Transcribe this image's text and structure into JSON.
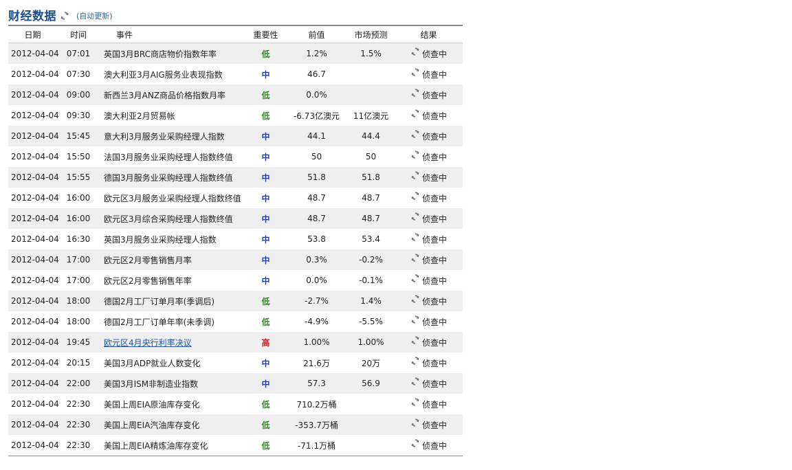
{
  "header": {
    "title": "财经数据",
    "auto_update": "(自动更新)"
  },
  "columns": [
    "日期",
    "时间",
    "事件",
    "重要性",
    "前值",
    "市场预测",
    "结果"
  ],
  "colors": {
    "low": "#2a8a1f",
    "medium": "#1e3fb4",
    "high": "#cc2222",
    "title": "#1f4e8c"
  },
  "rows": [
    {
      "date": "2012-04-04",
      "time": "07:01",
      "event": "英国3月BRC商店物价指数年率",
      "importance": "低",
      "level": "low",
      "previous": "1.2%",
      "forecast": "1.5%",
      "result": "侦查中"
    },
    {
      "date": "2012-04-04",
      "time": "07:30",
      "event": "澳大利亚3月AIG服务业表现指数",
      "importance": "中",
      "level": "medium",
      "previous": "46.7",
      "forecast": "",
      "result": "侦查中"
    },
    {
      "date": "2012-04-04",
      "time": "09:00",
      "event": "新西兰3月ANZ商品价格指数月率",
      "importance": "低",
      "level": "low",
      "previous": "0.0%",
      "forecast": "",
      "result": "侦查中"
    },
    {
      "date": "2012-04-04",
      "time": "09:30",
      "event": "澳大利亚2月贸易帐",
      "importance": "低",
      "level": "low",
      "previous": "-6.73亿澳元",
      "forecast": "11亿澳元",
      "result": "侦查中"
    },
    {
      "date": "2012-04-04",
      "time": "15:45",
      "event": "意大利3月服务业采购经理人指数",
      "importance": "中",
      "level": "medium",
      "previous": "44.1",
      "forecast": "44.4",
      "result": "侦查中"
    },
    {
      "date": "2012-04-04",
      "time": "15:50",
      "event": "法国3月服务业采购经理人指数终值",
      "importance": "中",
      "level": "medium",
      "previous": "50",
      "forecast": "50",
      "result": "侦查中"
    },
    {
      "date": "2012-04-04",
      "time": "15:55",
      "event": "德国3月服务业采购经理人指数终值",
      "importance": "中",
      "level": "medium",
      "previous": "51.8",
      "forecast": "51.8",
      "result": "侦查中"
    },
    {
      "date": "2012-04-04",
      "time": "16:00",
      "event": "欧元区3月服务业采购经理人指数终值",
      "importance": "中",
      "level": "medium",
      "previous": "48.7",
      "forecast": "48.7",
      "result": "侦查中"
    },
    {
      "date": "2012-04-04",
      "time": "16:00",
      "event": "欧元区3月综合采购经理人指数终值",
      "importance": "中",
      "level": "medium",
      "previous": "48.7",
      "forecast": "48.7",
      "result": "侦查中"
    },
    {
      "date": "2012-04-04",
      "time": "16:30",
      "event": "英国3月服务业采购经理人指数",
      "importance": "中",
      "level": "medium",
      "previous": "53.8",
      "forecast": "53.4",
      "result": "侦查中"
    },
    {
      "date": "2012-04-04",
      "time": "17:00",
      "event": "欧元区2月零售销售月率",
      "importance": "中",
      "level": "medium",
      "previous": "0.3%",
      "forecast": "-0.2%",
      "result": "侦查中"
    },
    {
      "date": "2012-04-04",
      "time": "17:00",
      "event": "欧元区2月零售销售年率",
      "importance": "中",
      "level": "medium",
      "previous": "0.0%",
      "forecast": "-0.1%",
      "result": "侦查中"
    },
    {
      "date": "2012-04-04",
      "time": "18:00",
      "event": "德国2月工厂订单月率(季调后)",
      "importance": "低",
      "level": "low",
      "previous": "-2.7%",
      "forecast": "1.4%",
      "result": "侦查中"
    },
    {
      "date": "2012-04-04",
      "time": "18:00",
      "event": "德国2月工厂订单年率(未季调)",
      "importance": "低",
      "level": "low",
      "previous": "-4.9%",
      "forecast": "-5.5%",
      "result": "侦查中"
    },
    {
      "date": "2012-04-04",
      "time": "19:45",
      "event": "欧元区4月央行利率决议",
      "importance": "高",
      "level": "high",
      "previous": "1.00%",
      "forecast": "1.00%",
      "result": "侦查中",
      "link": true
    },
    {
      "date": "2012-04-04",
      "time": "20:15",
      "event": "美国3月ADP就业人数变化",
      "importance": "中",
      "level": "medium",
      "previous": "21.6万",
      "forecast": "20万",
      "result": "侦查中"
    },
    {
      "date": "2012-04-04",
      "time": "22:00",
      "event": "美国3月ISM非制造业指数",
      "importance": "中",
      "level": "medium",
      "previous": "57.3",
      "forecast": "56.9",
      "result": "侦查中"
    },
    {
      "date": "2012-04-04",
      "time": "22:30",
      "event": "美国上周EIA原油库存变化",
      "importance": "低",
      "level": "low",
      "previous": "710.2万桶",
      "forecast": "",
      "result": "侦查中"
    },
    {
      "date": "2012-04-04",
      "time": "22:30",
      "event": "美国上周EIA汽油库存变化",
      "importance": "低",
      "level": "low",
      "previous": "-353.7万桶",
      "forecast": "",
      "result": "侦查中"
    },
    {
      "date": "2012-04-04",
      "time": "22:30",
      "event": "美国上周EIA精炼油库存变化",
      "importance": "低",
      "level": "low",
      "previous": "-71.1万桶",
      "forecast": "",
      "result": "侦查中"
    }
  ]
}
